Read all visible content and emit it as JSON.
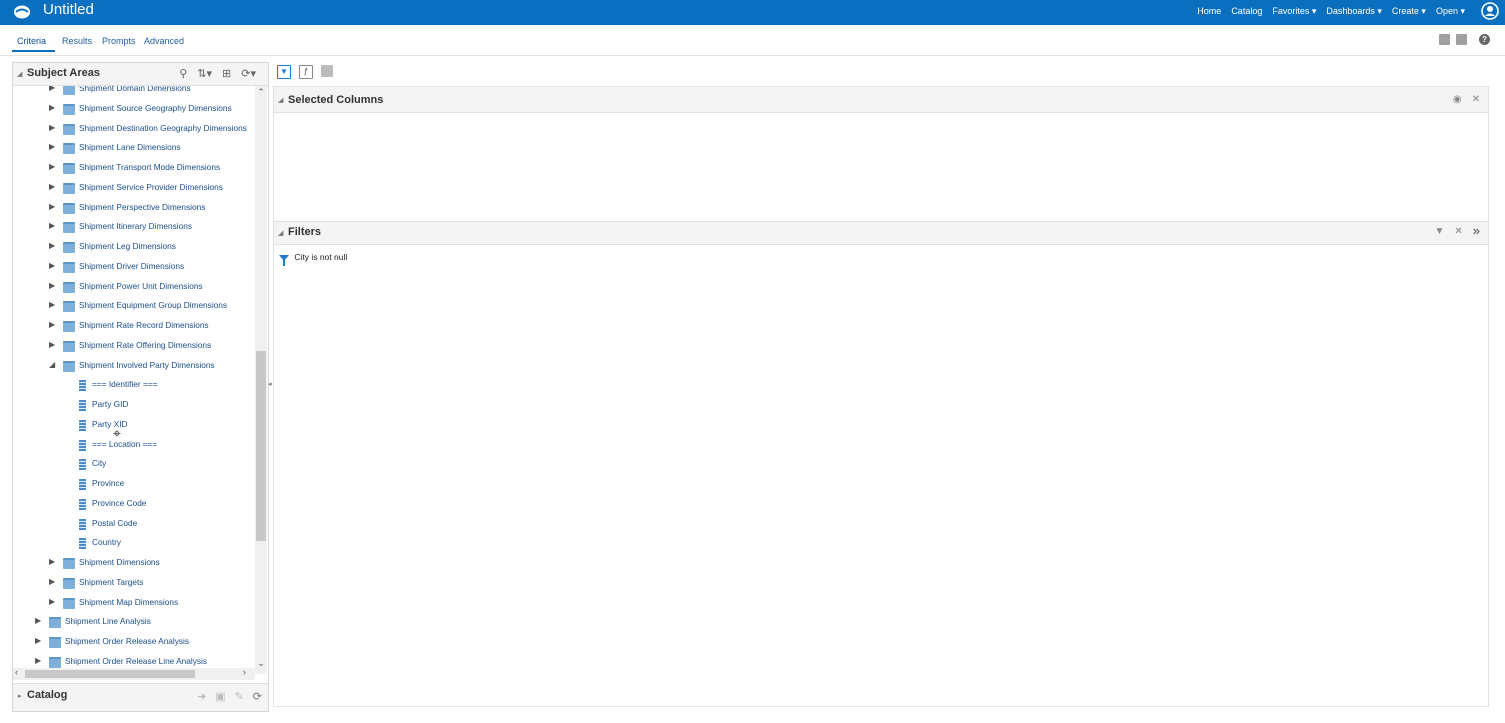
{
  "app": {
    "title": "Untitled",
    "nav": [
      "Home",
      "Catalog",
      "Favorites ▾",
      "Dashboards ▾",
      "Create ▾",
      "Open ▾"
    ]
  },
  "tabs": [
    "Criteria",
    "Results",
    "Prompts",
    "Advanced"
  ],
  "subject_areas": {
    "title": "Subject Areas",
    "tree": [
      {
        "label": "Shipment Domain Dimensions",
        "level": 2,
        "type": "folder",
        "expanded": false
      },
      {
        "label": "Shipment Source Geography Dimensions",
        "level": 2,
        "type": "folder",
        "expanded": false
      },
      {
        "label": "Shipment Destination Geography Dimensions",
        "level": 2,
        "type": "folder",
        "expanded": false
      },
      {
        "label": "Shipment Lane Dimensions",
        "level": 2,
        "type": "folder",
        "expanded": false
      },
      {
        "label": "Shipment Transport Mode Dimensions",
        "level": 2,
        "type": "folder",
        "expanded": false
      },
      {
        "label": "Shipment Service Provider Dimensions",
        "level": 2,
        "type": "folder",
        "expanded": false
      },
      {
        "label": "Shipment Perspective Dimensions",
        "level": 2,
        "type": "folder",
        "expanded": false
      },
      {
        "label": "Shipment Itinerary Dimensions",
        "level": 2,
        "type": "folder",
        "expanded": false
      },
      {
        "label": "Shipment Leg Dimensions",
        "level": 2,
        "type": "folder",
        "expanded": false
      },
      {
        "label": "Shipment Driver Dimensions",
        "level": 2,
        "type": "folder",
        "expanded": false
      },
      {
        "label": "Shipment Power Unit Dimensions",
        "level": 2,
        "type": "folder",
        "expanded": false
      },
      {
        "label": "Shipment Equipment Group Dimensions",
        "level": 2,
        "type": "folder",
        "expanded": false
      },
      {
        "label": "Shipment Rate Record Dimensions",
        "level": 2,
        "type": "folder",
        "expanded": false
      },
      {
        "label": "Shipment Rate Offering Dimensions",
        "level": 2,
        "type": "folder",
        "expanded": false
      },
      {
        "label": "Shipment Involved Party Dimensions",
        "level": 2,
        "type": "folder",
        "expanded": true
      },
      {
        "label": "=== Identifier ===",
        "level": 3,
        "type": "column"
      },
      {
        "label": "Party GID",
        "level": 3,
        "type": "column"
      },
      {
        "label": "Party XID",
        "level": 3,
        "type": "column"
      },
      {
        "label": "=== Location ===",
        "level": 3,
        "type": "column"
      },
      {
        "label": "City",
        "level": 3,
        "type": "column"
      },
      {
        "label": "Province",
        "level": 3,
        "type": "column"
      },
      {
        "label": "Province Code",
        "level": 3,
        "type": "column"
      },
      {
        "label": "Postal Code",
        "level": 3,
        "type": "column"
      },
      {
        "label": "Country",
        "level": 3,
        "type": "column"
      },
      {
        "label": "Shipment Dimensions",
        "level": 2,
        "type": "folder",
        "expanded": false
      },
      {
        "label": "Shipment Targets",
        "level": 2,
        "type": "folder",
        "expanded": false
      },
      {
        "label": "Shipment Map Dimensions",
        "level": 2,
        "type": "folder",
        "expanded": false
      },
      {
        "label": "Shipment Line Analysis",
        "level": 1,
        "type": "folder",
        "expanded": false
      },
      {
        "label": "Shipment Order Release Analysis",
        "level": 1,
        "type": "folder",
        "expanded": false
      },
      {
        "label": "Shipment Order Release Line Analysis",
        "level": 1,
        "type": "folder",
        "expanded": false
      }
    ]
  },
  "catalog": {
    "title": "Catalog"
  },
  "selected_columns": {
    "title": "Selected Columns"
  },
  "filters": {
    "title": "Filters",
    "items": [
      "City is not null"
    ]
  },
  "colors": {
    "header_bg": "#0b6fc0",
    "link": "#1b4f8a"
  }
}
